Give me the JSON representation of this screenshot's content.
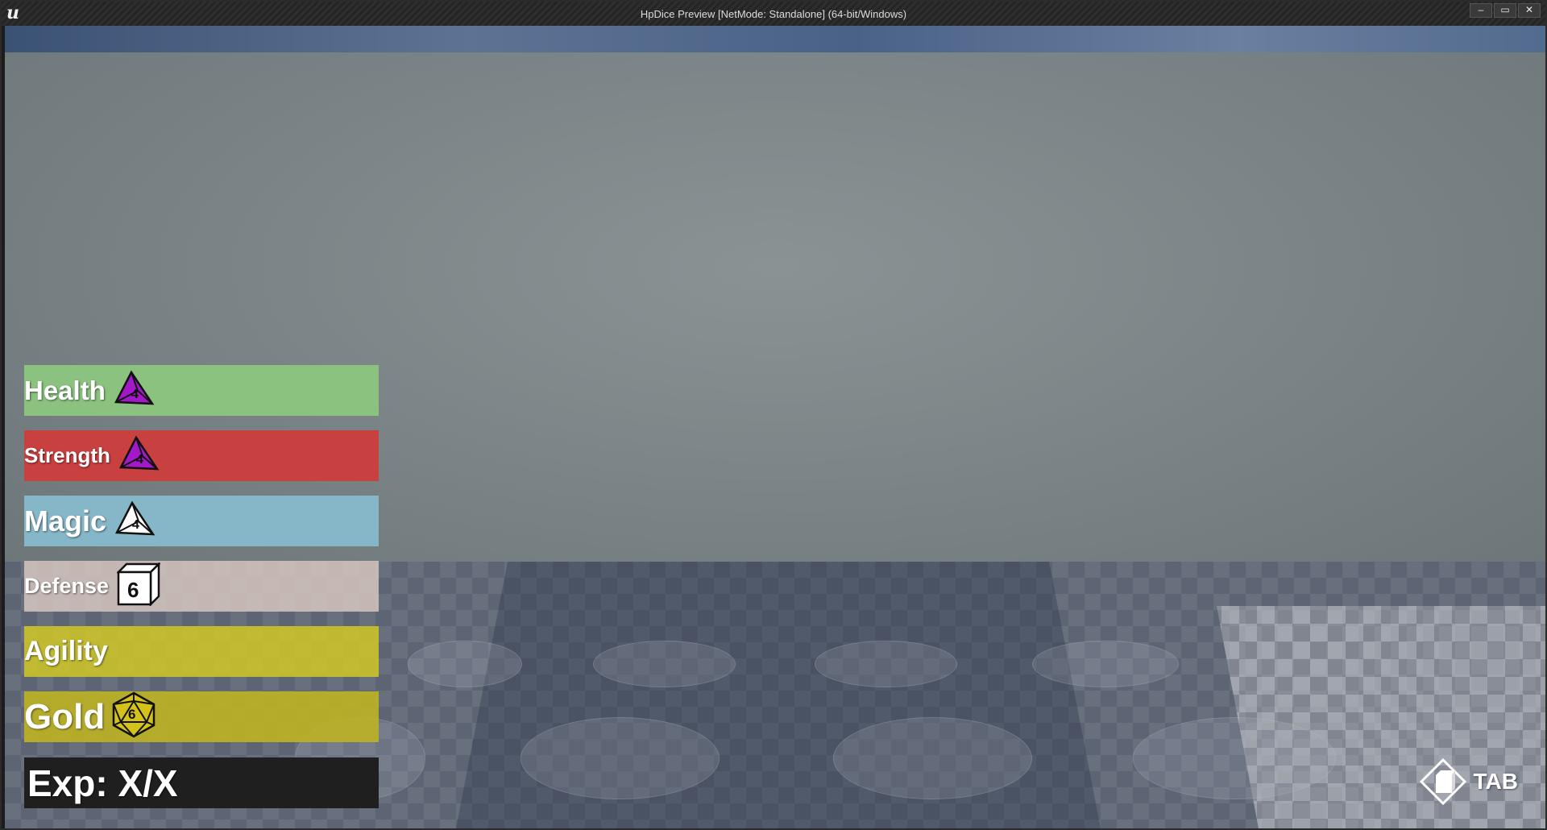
{
  "window": {
    "title": "HpDice Preview [NetMode: Standalone]  (64-bit/Windows)",
    "buttons": [
      "–",
      "▭",
      "✕"
    ]
  },
  "stats": [
    {
      "label": "Health",
      "die_type": "d4",
      "die_value": "4",
      "bar_color": "#8bc27f",
      "die_color": "#a318c8"
    },
    {
      "label": "Strength",
      "die_type": "d4",
      "die_value": "4",
      "bar_color": "#c94040",
      "die_color": "#a318c8"
    },
    {
      "label": "Magic",
      "die_type": "d4",
      "die_value": "4",
      "bar_color": "#86b7c8",
      "die_color": "#ffffff"
    },
    {
      "label": "Defense",
      "die_type": "d6",
      "die_value": "6",
      "bar_color": "#c8b9b2",
      "die_color": "#ffffff"
    },
    {
      "label": "Agility",
      "die_type": "",
      "die_value": "",
      "bar_color": "#c9c033",
      "die_color": ""
    },
    {
      "label": "Gold",
      "die_type": "d20",
      "die_value": "6",
      "bar_color": "#bfb42a",
      "die_color": "#d4c21a"
    }
  ],
  "exp": {
    "label": "Exp: X/X",
    "bar_color": "#1f1f1f"
  },
  "tab_hint": {
    "label": "TAB",
    "icon": "cube-diamond-icon"
  }
}
